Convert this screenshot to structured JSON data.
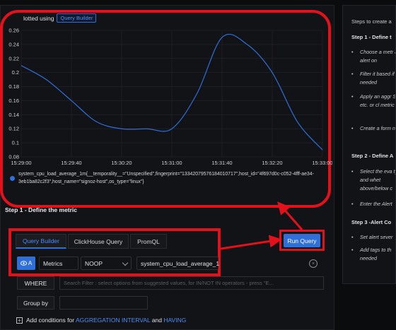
{
  "chart_header": {
    "plotted_label": "lotted using",
    "badge": "Query Builder"
  },
  "chart_data": {
    "type": "line",
    "x": [
      "15:29:00",
      "15:29:40",
      "15:30:20",
      "15:31:00",
      "15:31:40",
      "15:32:20",
      "15:33:00"
    ],
    "yticks": [
      0.26,
      0.24,
      0.22,
      0.2,
      0.18,
      0.16,
      0.14,
      0.12,
      0.1,
      0.08
    ],
    "ytick_labels": [
      "0.26",
      "0.24",
      "0.22",
      "0.2",
      "0.18",
      "0.16",
      "0.14",
      "0.12",
      "0.1",
      "0.08"
    ],
    "ylim": [
      0.08,
      0.26
    ],
    "grid": true,
    "series": [
      {
        "name": "system_cpu_load_average_1m{__temporality__=\"Unspecified\",fingerprint=\"13342079576184010717\",host_id=\"4f697d0c-c052-4fff-ae34-3eb1ba82c2f3\",host_name=\"signoz-host\",os_type=\"linux\"}",
        "color": "#2f6fd8",
        "points": [
          [
            "15:29:00",
            0.21
          ],
          [
            "15:29:20",
            0.19
          ],
          [
            "15:29:40",
            0.16
          ],
          [
            "15:30:00",
            0.13
          ],
          [
            "15:30:20",
            0.12
          ],
          [
            "15:30:40",
            0.12
          ],
          [
            "15:31:00",
            0.12
          ],
          [
            "15:31:20",
            0.17
          ],
          [
            "15:31:40",
            0.25
          ],
          [
            "15:32:00",
            0.24
          ],
          [
            "15:32:20",
            0.2
          ],
          [
            "15:32:40",
            0.13
          ],
          [
            "15:33:00",
            0.09
          ]
        ]
      }
    ]
  },
  "legend": {
    "series_text": "system_cpu_load_average_1m{__temporality__=\"Unspecified\",fingerprint=\"13342079576184010717\",host_id=\"4f697d0c-c052-4fff-ae34-3eb1ba82c2f3\",host_name=\"signoz-host\",os_type=\"linux\"}"
  },
  "step1_title": "Step 1 - Define the metric",
  "tabs": [
    "Query Builder",
    "ClickHouse Query",
    "PromQL"
  ],
  "run_query": "Run Query",
  "query_row": {
    "letter": "A",
    "source": "Metrics",
    "aggregate": "NOOP",
    "metric_value": "system_cpu_load_average_1",
    "clear_glyph": "×"
  },
  "where": {
    "label": "WHERE",
    "placeholder": "Search Filter : select options from suggested values, for IN/NOT IN operators - press \"E..."
  },
  "group_by": {
    "label": "Group by"
  },
  "add_conditions": {
    "plus": "+",
    "prefix": "Add conditions for",
    "agg_link": "AGGREGATION INTERVAL",
    "and": "and",
    "having_link": "HAVING"
  },
  "right_panel": {
    "intro": "Steps to create a",
    "step1": "Step 1 - Define t",
    "step1_items": [
      "Choose a metr an alert on",
      "Filter it based if needed",
      "Apply an aggr SUM, etc. or cl metric",
      "Create a form needed"
    ],
    "step2": "Step 2 - Define A",
    "step2_items": [
      "Select the eva type and whet above/below c",
      "Enter the Alert"
    ],
    "step3": "Step 3 -Alert Co",
    "step3_items": [
      "Set alert sever",
      "Add tags to th needed"
    ]
  },
  "colors": {
    "accent": "#2f6fd8",
    "annotation_red": "#e3111b",
    "background": "#0b0c0e",
    "panel": "#121317"
  }
}
